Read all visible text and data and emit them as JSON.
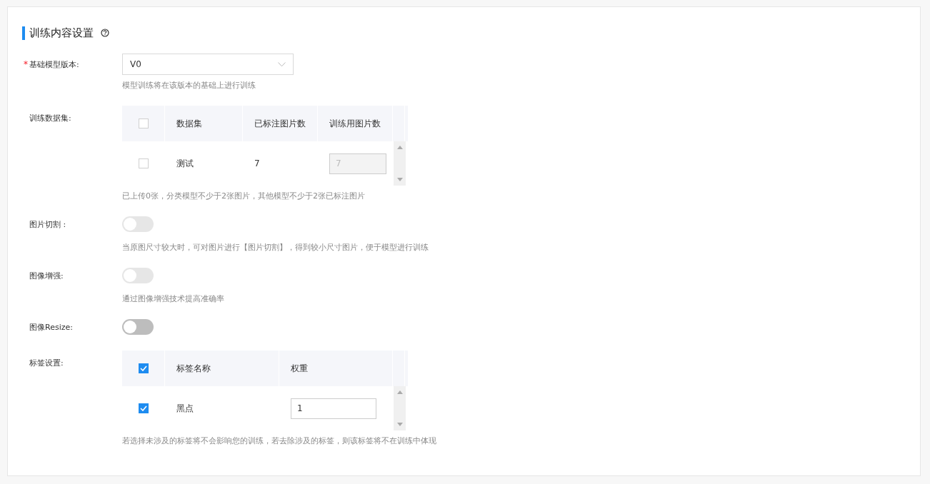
{
  "section": {
    "title": "训练内容设置"
  },
  "fields": [
    {
      "kind": "select",
      "label": "基础模型版本:",
      "required_mark": "*",
      "value": "V0",
      "hint": "模型训练将在该版本的基础上进行训练"
    },
    {
      "kind": "table",
      "label": "训练数据集:",
      "columns": [
        "数据集",
        "已标注图片数",
        "训练用图片数"
      ],
      "all_checked": false,
      "rows": [
        {
          "checked": false,
          "cells": [
            "测试",
            "7"
          ],
          "input": "7",
          "input_disabled": true
        }
      ],
      "hint": "已上传0张，分类模型不少于2张图片，其他模型不少于2张已标注图片"
    },
    {
      "kind": "switch",
      "label": "图片切割 :",
      "on": false,
      "disabled": true,
      "hint": "当原图尺寸较大时，可对图片进行【图片切割】，得到较小尺寸图片，便于模型进行训练"
    },
    {
      "kind": "switch",
      "label": "图像增强:",
      "on": false,
      "disabled": true,
      "hint": "通过图像增强技术提高准确率"
    },
    {
      "kind": "switch",
      "label": "图像Resize:",
      "on": false,
      "disabled": false
    },
    {
      "kind": "table",
      "label": "标签设置:",
      "columns": [
        "标签名称",
        "权重"
      ],
      "all_checked": true,
      "rows": [
        {
          "checked": true,
          "cells": [
            "黑点"
          ],
          "input": "1",
          "input_disabled": false
        }
      ],
      "hint": "若选择未涉及的标签将不会影响您的训练，若去除涉及的标签，则该标签将不在训练中体现"
    }
  ]
}
